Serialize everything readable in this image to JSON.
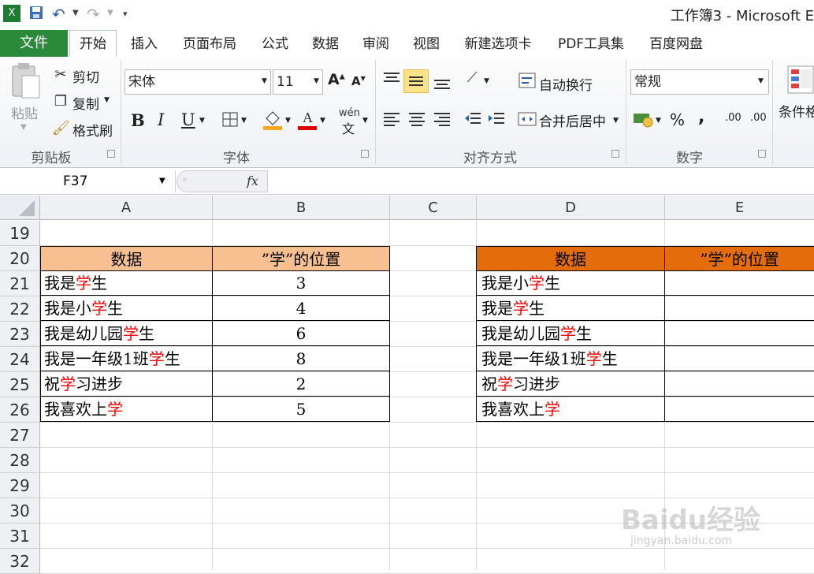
{
  "window": {
    "title": "工作簿3 - Microsoft E"
  },
  "menu": {
    "file": "文件",
    "tabs": [
      "开始",
      "插入",
      "页面布局",
      "公式",
      "数据",
      "审阅",
      "视图",
      "新建选项卡",
      "PDF工具集",
      "百度网盘"
    ]
  },
  "ribbon": {
    "clipboard": {
      "paste": "粘贴",
      "cut": "剪切",
      "copy": "复制",
      "format_painter": "格式刷",
      "group": "剪贴板"
    },
    "font": {
      "name": "宋体",
      "size": "11",
      "group": "字体",
      "bold": "B",
      "italic": "I",
      "underline": "U",
      "wen": "wén"
    },
    "alignment": {
      "wrap": "自动换行",
      "merge": "合并后居中",
      "group": "对齐方式"
    },
    "number": {
      "format": "常规",
      "percent": "%",
      "comma": ",",
      "group": "数字",
      "inc_dec": ".00",
      "dec_dec": ".00"
    },
    "styles": {
      "conditional": "条件格"
    }
  },
  "formula_bar": {
    "name_box": "F37",
    "fx": "fx",
    "content": ""
  },
  "sheet": {
    "columns": [
      "A",
      "B",
      "C",
      "D",
      "E"
    ],
    "rows": [
      "19",
      "20",
      "21",
      "22",
      "23",
      "24",
      "25",
      "26",
      "27",
      "28",
      "29",
      "30",
      "31",
      "32"
    ],
    "table1": {
      "header": [
        "数据",
        "”学”的位置"
      ],
      "rows": [
        {
          "pre": "我是",
          "hl": "学",
          "post": "生",
          "pos": "3"
        },
        {
          "pre": "我是小",
          "hl": "学",
          "post": "生",
          "pos": "4"
        },
        {
          "pre": "我是幼儿园",
          "hl": "学",
          "post": "生",
          "pos": "6"
        },
        {
          "pre": "我是一年级1班",
          "hl": "学",
          "post": "生",
          "pos": "8"
        },
        {
          "pre": "祝",
          "hl": "学",
          "post": "习进步",
          "pos": "2"
        },
        {
          "pre": "我喜欢上",
          "hl": "学",
          "post": "",
          "pos": "5"
        }
      ]
    },
    "table2": {
      "header": [
        "数据",
        "”学”的位置"
      ],
      "rows": [
        {
          "pre": "我是小",
          "hl": "学",
          "post": "生"
        },
        {
          "pre": "我是",
          "hl": "学",
          "post": "生"
        },
        {
          "pre": "我是幼儿园",
          "hl": "学",
          "post": "生"
        },
        {
          "pre": "我是一年级1班",
          "hl": "学",
          "post": "生"
        },
        {
          "pre": "祝",
          "hl": "学",
          "post": "习进步"
        },
        {
          "pre": "我喜欢上",
          "hl": "学",
          "post": ""
        }
      ]
    },
    "colors": {
      "table1_header": "#f8c090",
      "table2_header": "#e46c0a",
      "highlight": "#ff0000"
    }
  },
  "watermark": {
    "brand": "Baidu经验",
    "url": "jingyan.baidu.com"
  }
}
